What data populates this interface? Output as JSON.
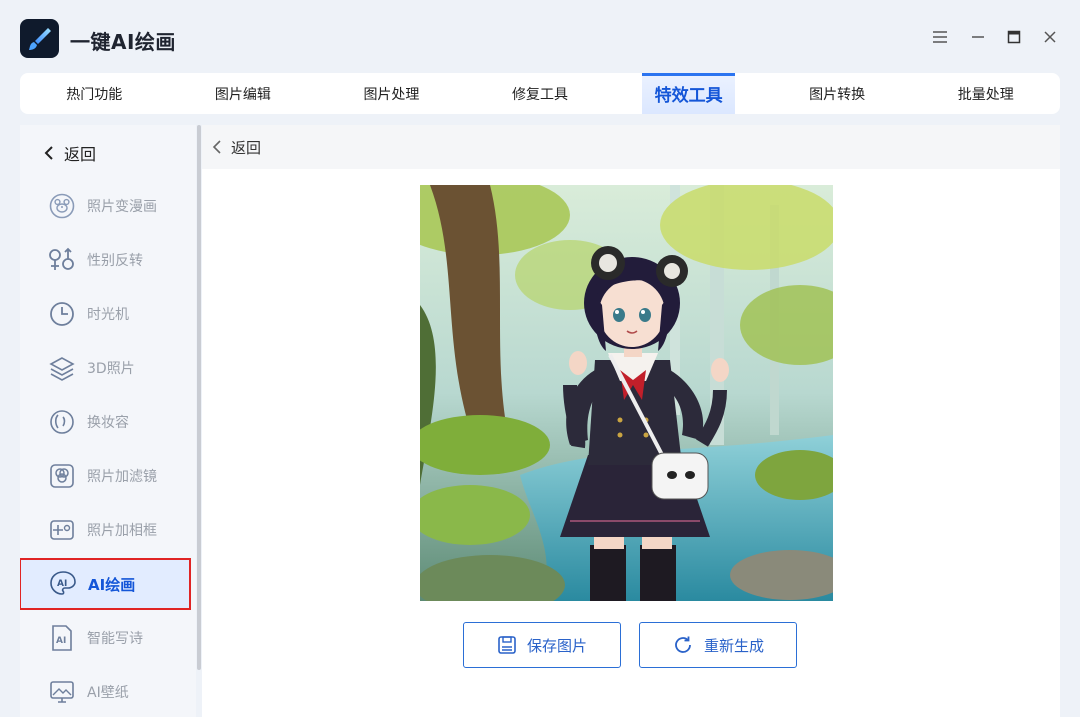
{
  "app": {
    "title": "一键AI绘画",
    "icon": "paintbrush-logo-icon",
    "accent": "#1456d8"
  },
  "window_controls": [
    "menu-icon",
    "minimize-icon",
    "maximize-icon",
    "close-icon"
  ],
  "tabs": [
    {
      "label": "热门功能",
      "active": false
    },
    {
      "label": "图片编辑",
      "active": false
    },
    {
      "label": "图片处理",
      "active": false
    },
    {
      "label": "修复工具",
      "active": false
    },
    {
      "label": "特效工具",
      "active": true
    },
    {
      "label": "图片转换",
      "active": false
    },
    {
      "label": "批量处理",
      "active": false
    }
  ],
  "sidebar": {
    "back_label": "返回",
    "items": [
      {
        "label": "照片变漫画",
        "icon": "bear-face-icon"
      },
      {
        "label": "性别反转",
        "icon": "gender-swap-icon"
      },
      {
        "label": "时光机",
        "icon": "clock-icon"
      },
      {
        "label": "3D照片",
        "icon": "layers-icon"
      },
      {
        "label": "换妆容",
        "icon": "face-profile-icon"
      },
      {
        "label": "照片加滤镜",
        "icon": "filter-circles-icon"
      },
      {
        "label": "照片加相框",
        "icon": "frame-plus-icon"
      },
      {
        "label": "AI绘画",
        "icon": "ai-palette-icon",
        "active": true
      },
      {
        "label": "智能写诗",
        "icon": "ai-document-icon"
      },
      {
        "label": "AI壁纸",
        "icon": "wallpaper-icon"
      }
    ]
  },
  "main": {
    "back_label": "返回",
    "save_label": "保存图片",
    "regenerate_label": "重新生成"
  },
  "colors": {
    "active_border": "#e02424",
    "button_border": "#2b6fd6"
  }
}
